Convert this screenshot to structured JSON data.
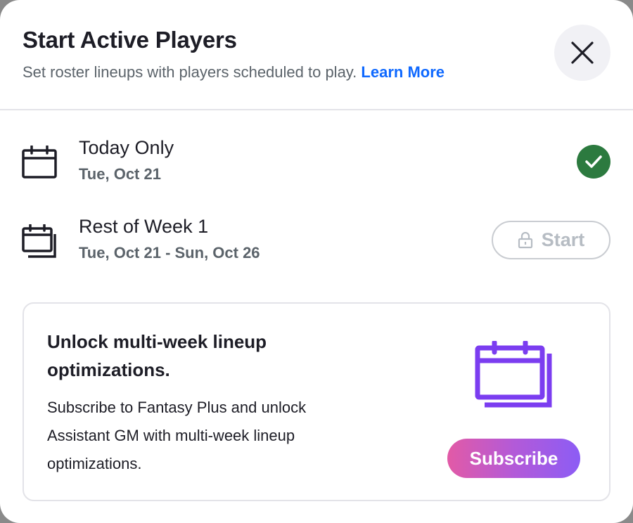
{
  "header": {
    "title": "Start Active Players",
    "subtitle": "Set roster lineups with players scheduled to play.",
    "learn_more_label": "Learn More"
  },
  "options": [
    {
      "title": "Today Only",
      "date": "Tue, Oct 21",
      "status": "selected",
      "icon": "calendar-icon"
    },
    {
      "title": "Rest of Week 1",
      "date": "Tue, Oct 21 - Sun, Oct 26",
      "status": "locked",
      "button_label": "Start",
      "icon": "calendar-stack-icon"
    }
  ],
  "promo": {
    "title": "Unlock multi-week lineup optimizations.",
    "body": "Subscribe to Fantasy Plus and unlock Assistant GM with multi-week lineup optimizations.",
    "button_label": "Subscribe",
    "icon": "calendar-stack-icon"
  },
  "colors": {
    "accent_link": "#0f69ff",
    "success": "#2c7a3f",
    "promo_purple": "#7b3df0",
    "subscribe_gradient": [
      "#e25aa6",
      "#8c5cf5"
    ]
  }
}
